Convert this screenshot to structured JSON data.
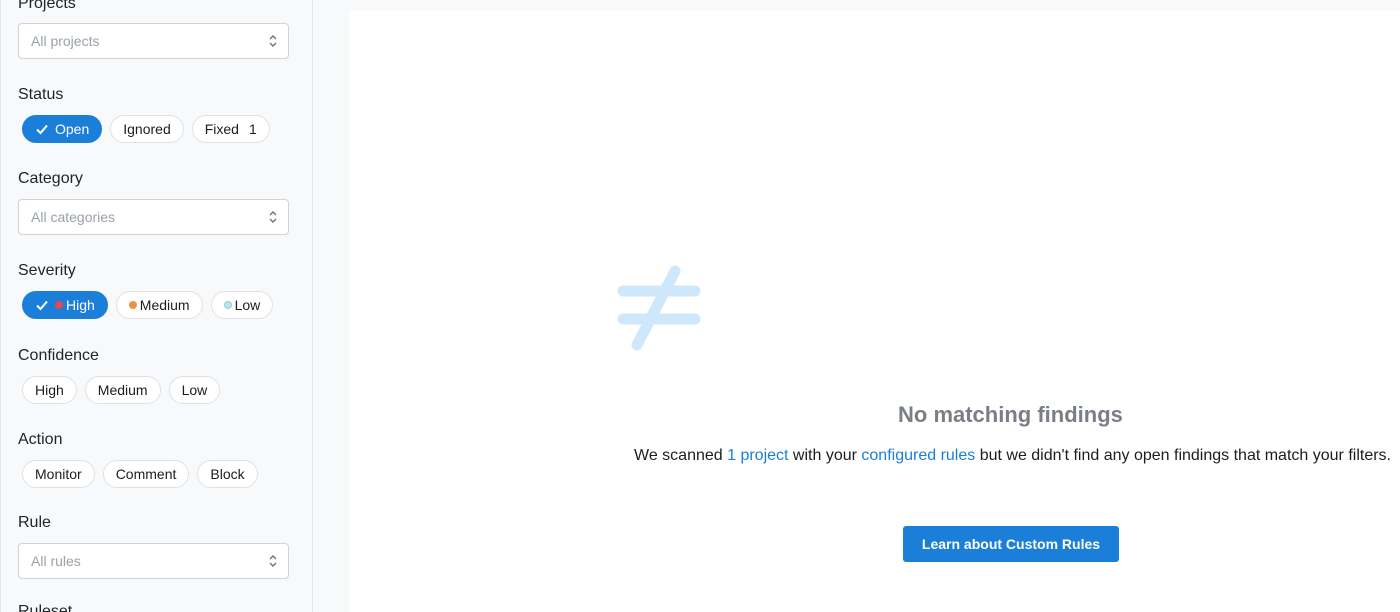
{
  "filters": {
    "projects": {
      "title": "Projects",
      "placeholder": "All projects"
    },
    "status": {
      "title": "Status",
      "options": [
        {
          "label": "Open",
          "active": true
        },
        {
          "label": "Ignored",
          "active": false
        },
        {
          "label": "Fixed",
          "active": false,
          "count": "1"
        }
      ]
    },
    "category": {
      "title": "Category",
      "placeholder": "All categories"
    },
    "severity": {
      "title": "Severity",
      "options": [
        {
          "label": "High",
          "active": true,
          "dot_color": "#e5484d"
        },
        {
          "label": "Medium",
          "active": false,
          "dot_color": "#e8934a"
        },
        {
          "label": "Low",
          "active": false,
          "dot_color": "#b8e6e6"
        }
      ]
    },
    "confidence": {
      "title": "Confidence",
      "options": [
        {
          "label": "High"
        },
        {
          "label": "Medium"
        },
        {
          "label": "Low"
        }
      ]
    },
    "action": {
      "title": "Action",
      "options": [
        {
          "label": "Monitor"
        },
        {
          "label": "Comment"
        },
        {
          "label": "Block"
        }
      ]
    },
    "rule": {
      "title": "Rule",
      "placeholder": "All rules"
    },
    "next_section_title": "Ruleset"
  },
  "empty_state": {
    "icon": "not-equal-icon",
    "title": "No matching findings",
    "desc_prefix": "We scanned ",
    "projects_link": "1 project",
    "desc_mid": " with your ",
    "rules_link": "configured rules",
    "desc_suffix": " but we didn't find any open findings that match your filters.",
    "cta_label": "Learn about Custom Rules"
  },
  "colors": {
    "accent": "#1b7fd9",
    "icon_light": "#cfe7fb"
  }
}
